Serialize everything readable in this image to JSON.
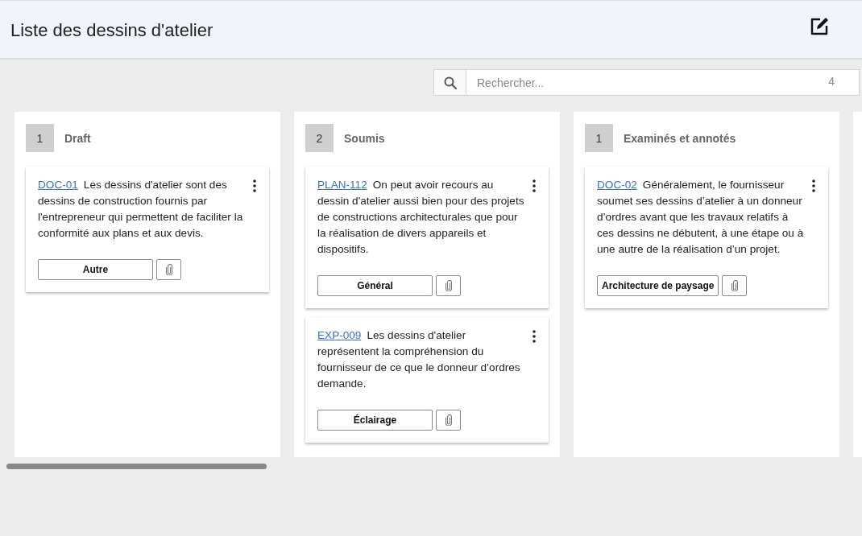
{
  "header": {
    "title": "Liste des dessins d'atelier"
  },
  "search": {
    "placeholder": "Rechercher...",
    "count": "4"
  },
  "columns": [
    {
      "count": "1",
      "title": "Draft",
      "cards": [
        {
          "code": "DOC-01",
          "text": "Les dessins d'atelier sont des dessins de construction fournis par l'entrepreneur qui permettent de faciliter la conformité aux plans et aux devis.",
          "tag": "Autre"
        }
      ]
    },
    {
      "count": "2",
      "title": "Soumis",
      "cards": [
        {
          "code": "PLAN-112",
          "text": "On peut avoir recours au dessin d'atelier aussi bien pour des projets de constructions architecturales que pour la réalisation de divers appareils et dispositifs.",
          "tag": "Général"
        },
        {
          "code": "EXP-009",
          "text": "Les dessins d'atelier représentent la compréhension du fournisseur de ce que le donneur d’ordres demande.",
          "tag": "Éclairage"
        }
      ]
    },
    {
      "count": "1",
      "title": "Examinés et annotés",
      "cards": [
        {
          "code": "DOC-02",
          "text": "Généralement, le fournisseur soumet ses dessins d’atelier à un donneur d’ordres avant que les travaux relatifs à ces dessins ne débutent, à une étape ou à une autre de la réalisation d’un projet.",
          "tag": "Architecture de paysage"
        }
      ]
    }
  ]
}
